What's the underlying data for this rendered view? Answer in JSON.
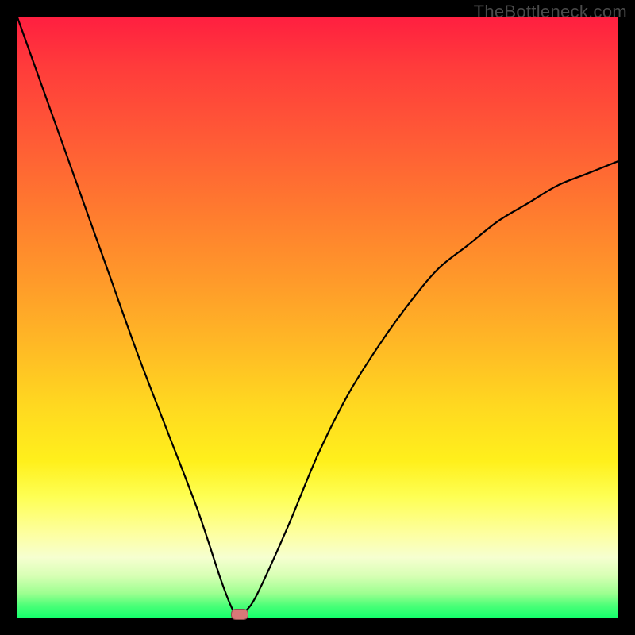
{
  "watermark": "TheBottleneck.com",
  "colors": {
    "bg": "#000000",
    "marker": "#d87878",
    "curve": "#000000"
  },
  "chart_data": {
    "type": "line",
    "title": "",
    "xlabel": "",
    "ylabel": "",
    "xlim": [
      0,
      100
    ],
    "ylim": [
      0,
      100
    ],
    "grid": false,
    "legend": false,
    "background": "rainbow-gradient-red-to-green",
    "series": [
      {
        "name": "v-curve",
        "x": [
          0,
          5,
          10,
          15,
          20,
          25,
          30,
          34,
          36,
          37,
          38,
          40,
          45,
          50,
          55,
          60,
          65,
          70,
          75,
          80,
          85,
          90,
          95,
          100
        ],
        "values": [
          100,
          86,
          72,
          58,
          44,
          31,
          18,
          6,
          1,
          0,
          1,
          4,
          15,
          27,
          37,
          45,
          52,
          58,
          62,
          66,
          69,
          72,
          74,
          76
        ]
      }
    ],
    "annotations": [
      {
        "name": "minimum-marker",
        "x": 37,
        "y": 0.5,
        "shape": "pill",
        "color": "#d87878"
      }
    ]
  }
}
